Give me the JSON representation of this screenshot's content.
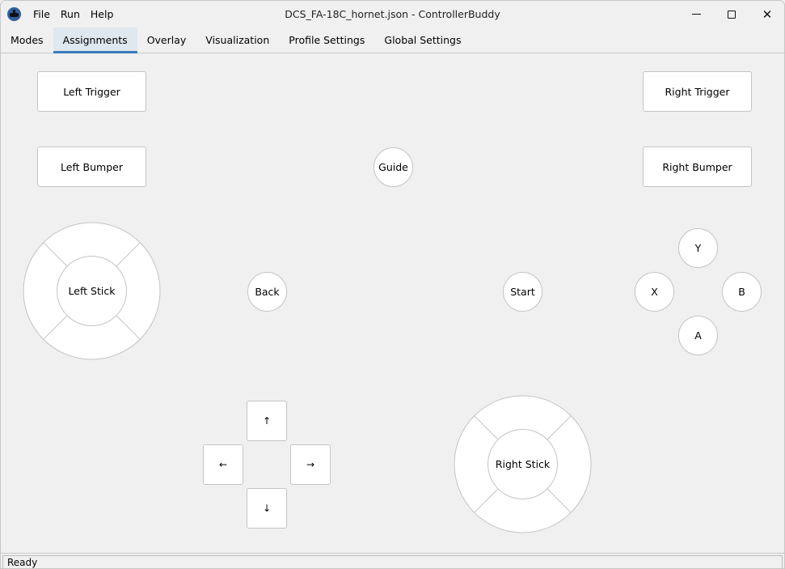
{
  "window": {
    "title": "DCS_FA-18C_hornet.json - ControllerBuddy",
    "icon": "controllerbuddy-app-icon",
    "controls": {
      "minimize": "minimize-icon",
      "maximize": "maximize-icon",
      "close": "close-icon",
      "close_glyph": "✕"
    }
  },
  "menu": {
    "items": [
      {
        "label": "File"
      },
      {
        "label": "Run"
      },
      {
        "label": "Help"
      }
    ]
  },
  "tabs": [
    {
      "label": "Modes",
      "active": false
    },
    {
      "label": "Assignments",
      "active": true
    },
    {
      "label": "Overlay",
      "active": false
    },
    {
      "label": "Visualization",
      "active": false
    },
    {
      "label": "Profile Settings",
      "active": false
    },
    {
      "label": "Global Settings",
      "active": false
    }
  ],
  "assignments": {
    "left_trigger": "Left Trigger",
    "left_bumper": "Left Bumper",
    "right_trigger": "Right Trigger",
    "right_bumper": "Right Bumper",
    "guide": "Guide",
    "back": "Back",
    "start": "Start",
    "face_buttons": {
      "y": "Y",
      "x": "X",
      "b": "B",
      "a": "A"
    },
    "left_stick": "Left Stick",
    "right_stick": "Right Stick",
    "dpad": {
      "up": "↑",
      "left": "←",
      "right": "→",
      "down": "↓"
    }
  },
  "status": {
    "text": "Ready"
  },
  "colors": {
    "accent": "#3c7bbd",
    "active_tab_bg": "#dfe7ef",
    "background": "#f0f0f0",
    "button_bg": "#ffffff",
    "button_border": "#c4c4c4"
  }
}
